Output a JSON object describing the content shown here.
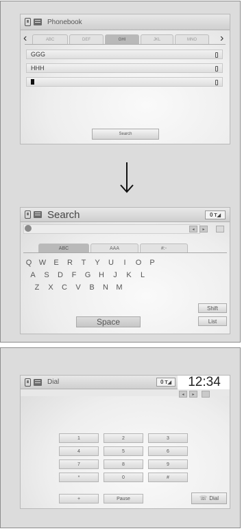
{
  "phonebook": {
    "title": "Phonebook",
    "tabs": [
      "ABC",
      "DEF",
      "GHI",
      "JKL",
      "MNO"
    ],
    "contacts": [
      "GGG",
      "HHH"
    ],
    "search_label": "Search"
  },
  "search": {
    "title": "Search",
    "signal": "0",
    "tabs": [
      "ABC",
      "AAA",
      "#:-"
    ],
    "keys_row1": [
      "Q",
      "W",
      "E",
      "R",
      "T",
      "Y",
      "U",
      "I",
      "O",
      "P"
    ],
    "keys_row2": [
      "A",
      "S",
      "D",
      "F",
      "G",
      "H",
      "J",
      "K",
      "L"
    ],
    "keys_row3": [
      "Z",
      "X",
      "C",
      "V",
      "B",
      "N",
      "M"
    ],
    "shift_label": "Shift",
    "list_label": "List",
    "space_label": "Space"
  },
  "dial": {
    "title": "Dial",
    "signal": "0",
    "clock": "12:34",
    "keypad": [
      [
        "1",
        "2",
        "3"
      ],
      [
        "4",
        "5",
        "6"
      ],
      [
        "7",
        "8",
        "9"
      ],
      [
        "*",
        "0",
        "#"
      ]
    ],
    "plus_label": "+",
    "pause_label": "Pause",
    "dial_label": "Dial"
  }
}
